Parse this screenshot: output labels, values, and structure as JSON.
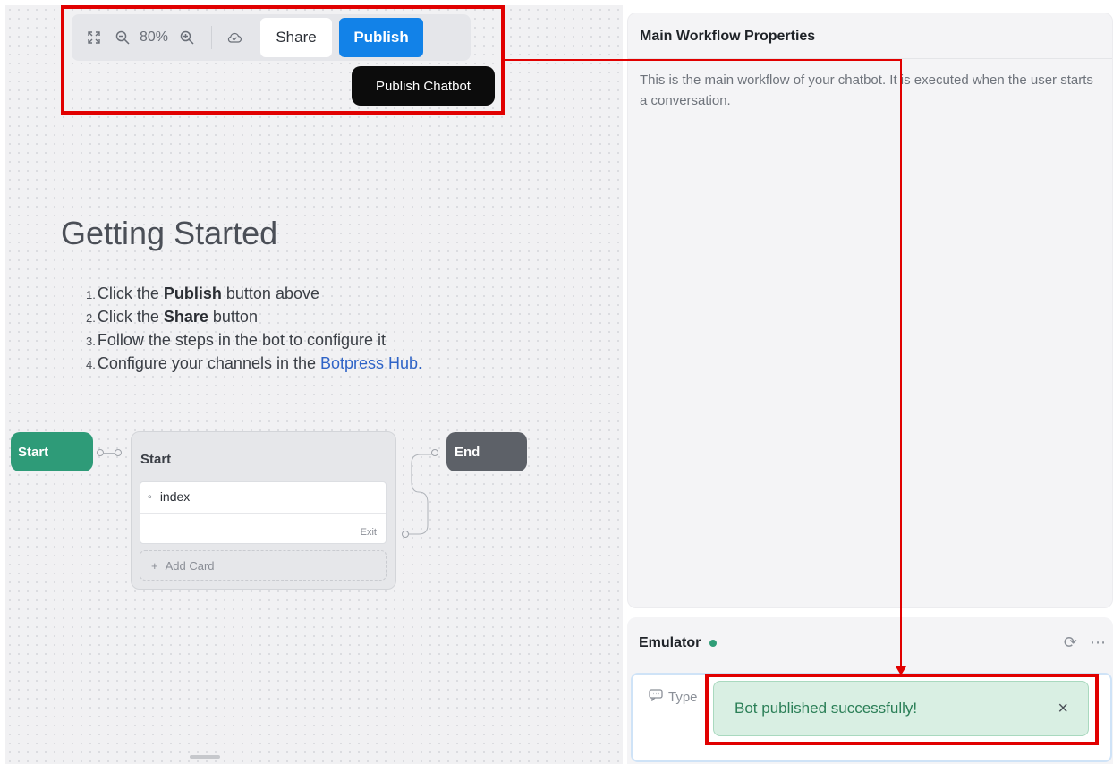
{
  "toolbar": {
    "zoom": "80%",
    "share_label": "Share",
    "publish_label": "Publish",
    "tooltip": "Publish Chatbot",
    "icons": [
      "fullscreen-icon",
      "zoom-out-icon",
      "zoom-in-icon",
      "cloud-check-icon"
    ]
  },
  "getting_started": {
    "title": "Getting Started",
    "steps": [
      {
        "num": "1.",
        "pre": "Click the ",
        "bold": "Publish",
        "post": " button above"
      },
      {
        "num": "2.",
        "pre": "Click the ",
        "bold": "Share",
        "post": " button"
      },
      {
        "num": "3.",
        "pre": "Follow the steps in the bot to configure it",
        "bold": "",
        "post": ""
      },
      {
        "num": "4.",
        "pre": "Configure your channels in the ",
        "link": "Botpress Hub.",
        "post": ""
      }
    ]
  },
  "flow": {
    "start_node": "Start",
    "end_node": "End",
    "card": {
      "title": "Start",
      "item": "index",
      "exit_label": "Exit",
      "add_card_label": "Add Card"
    }
  },
  "properties": {
    "title": "Main Workflow Properties",
    "description": "This is the main workflow of your chatbot. It is executed when the user starts a conversation."
  },
  "emulator": {
    "title": "Emulator",
    "status_color": "#2f9d77",
    "placeholder": "Type"
  },
  "toast": {
    "message": "Bot published successfully!",
    "close_icon": "×"
  },
  "colors": {
    "publish": "#1282e8",
    "start_node": "#2e9b78",
    "end_node": "#5d6168",
    "annotation": "#e10000",
    "toast_bg": "#d9efe3"
  }
}
